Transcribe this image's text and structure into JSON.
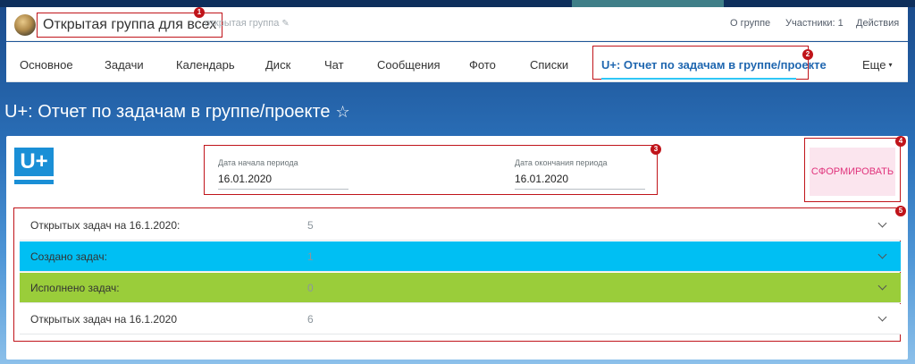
{
  "header": {
    "group_title": "Открытая группа для всех",
    "group_subtitle": "открытая группа",
    "links": [
      "О группе",
      "Участники: 1",
      "Действия"
    ]
  },
  "nav": {
    "items": [
      "Основное",
      "Задачи",
      "Календарь",
      "Диск",
      "Чат",
      "Сообщения",
      "Фото",
      "Списки"
    ],
    "active": "U+: Отчет по задачам в группе/проекте",
    "more": "Еще"
  },
  "page": {
    "title": "U+: Отчет по задачам в группе/проекте"
  },
  "logo": {
    "text": "U+"
  },
  "period": {
    "start_label": "Дата начала периода",
    "start_value": "16.01.2020",
    "end_label": "Дата окончания периода",
    "end_value": "16.01.2020"
  },
  "form_button": "СФОРМИРОВАТЬ",
  "rows": [
    {
      "label": "Открытых задач на 16.1.2020:",
      "value": "5",
      "color": "#ffffff"
    },
    {
      "label": "Создано задач:",
      "value": "1",
      "color": "#00bff3"
    },
    {
      "label": "Исполнено задач:",
      "value": "0",
      "color": "#9acd3a"
    },
    {
      "label": "Открытых задач на 16.1.2020",
      "value": "6",
      "color": "#ffffff"
    }
  ],
  "badges": [
    "1",
    "2",
    "3",
    "4",
    "5"
  ],
  "colors": {
    "accent_red": "#c0141a",
    "link_blue": "#2067b0",
    "tab_underline": "#2fc6f6",
    "button_text": "#e0337c",
    "button_bg": "#fbe5ee"
  }
}
